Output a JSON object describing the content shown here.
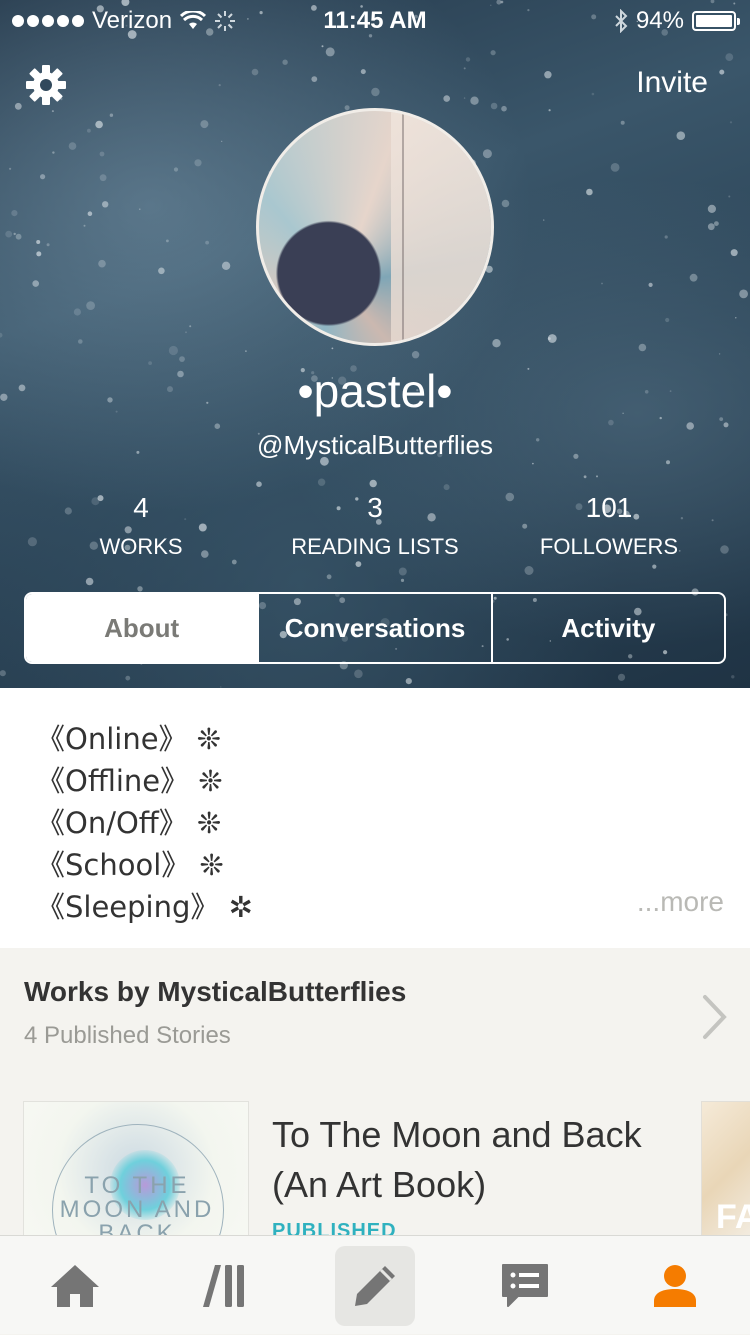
{
  "status_bar": {
    "carrier": "Verizon",
    "time": "11:45 AM",
    "battery": "94%",
    "battery_level": 0.94
  },
  "header": {
    "invite_label": "Invite",
    "display_name": "•pastel•",
    "username": "@MysticalButterflies",
    "stats": [
      {
        "value": "4",
        "label": "WORKS"
      },
      {
        "value": "3",
        "label": "READING LISTS"
      },
      {
        "value": "101",
        "label": "FOLLOWERS"
      }
    ],
    "tabs": [
      {
        "label": "About",
        "selected": true
      },
      {
        "label": "Conversations",
        "selected": false
      },
      {
        "label": "Activity",
        "selected": false
      }
    ]
  },
  "about": {
    "lines": [
      "《Online》 ❊",
      "《Offline》 ❊",
      "《On/Off》 ❊",
      "《School》 ❊",
      "《Sleeping》 ✲"
    ],
    "more_label": "...more"
  },
  "works": {
    "title": "Works by MysticalButterflies",
    "subtitle": "4 Published Stories",
    "items": [
      {
        "title": "To The Moon and Back (An Art Book)",
        "status": "PUBLISHED",
        "cover_text": [
          "TO THE",
          "MOON AND",
          "BACK"
        ]
      }
    ],
    "next_cover_text": "FA"
  },
  "tabbar": {
    "items": [
      "home-icon",
      "library-icon",
      "write-icon",
      "messages-icon",
      "profile-icon"
    ],
    "active": "profile-icon",
    "active_color": "#f57c00",
    "inactive_color": "#757575"
  },
  "colors": {
    "published": "#2fb1bf",
    "more_text": "#b9b9b5"
  }
}
